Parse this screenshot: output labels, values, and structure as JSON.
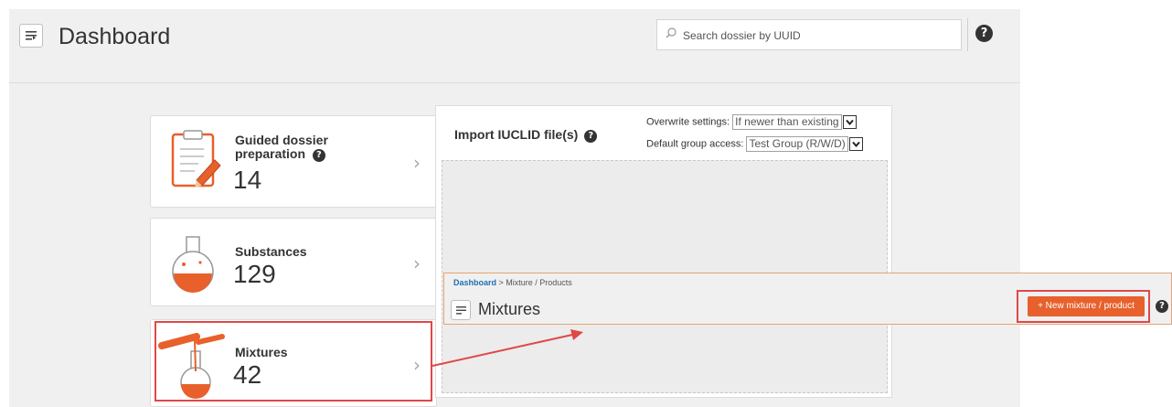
{
  "header": {
    "title": "Dashboard",
    "search_placeholder": "Search dossier by UUID",
    "help_glyph": "?"
  },
  "cards": [
    {
      "label_line1": "Guided dossier",
      "label_line2": "preparation",
      "count": "14",
      "icon": "clipboard-pencil-icon"
    },
    {
      "label": "Substances",
      "count": "129",
      "icon": "flask-icon"
    },
    {
      "label": "Mixtures",
      "count": "42",
      "icon": "mixing-flasks-icon"
    }
  ],
  "import_panel": {
    "title": "Import IUCLID file(s)",
    "overwrite_label": "Overwrite settings:",
    "overwrite_value": "If newer than existing",
    "group_label": "Default group access:",
    "group_value": "Test Group (R/W/D)"
  },
  "overlay": {
    "breadcrumb_link": "Dashboard",
    "breadcrumb_rest": " > Mixture / Products",
    "title": "Mixtures",
    "new_button": "+ New mixture / product"
  },
  "colors": {
    "accent": "#e8602c",
    "highlight": "#e04848",
    "link": "#1f6fb5"
  }
}
